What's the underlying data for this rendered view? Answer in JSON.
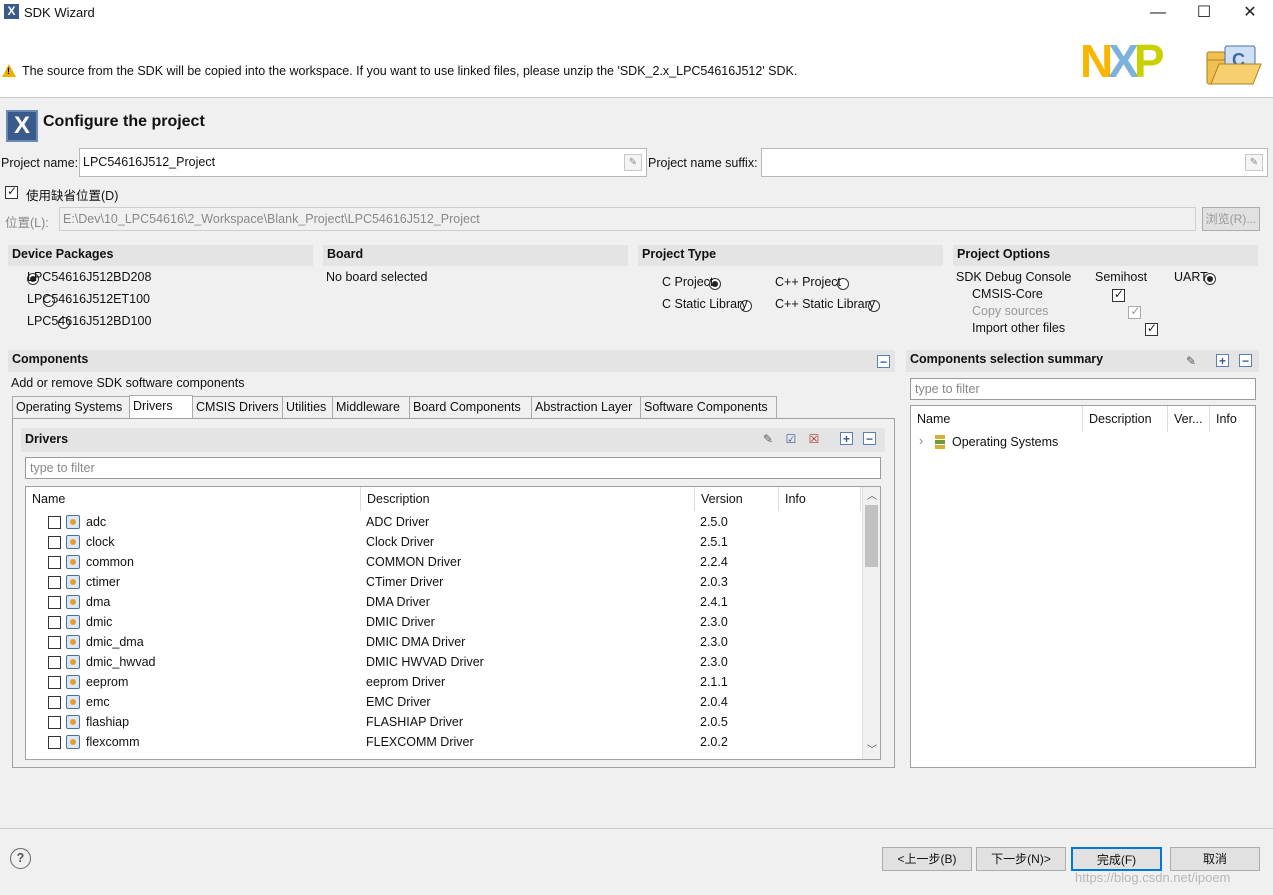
{
  "window": {
    "title": "SDK Wizard",
    "icon_glyph": "X",
    "minimize_glyph": "—",
    "maximize_glyph": "☐",
    "close_glyph": "✕"
  },
  "header": {
    "warning_glyph": "!",
    "message": "The source from the SDK will be copied into the workspace. If you want to use linked files, please unzip the 'SDK_2.x_LPC54616J512' SDK.",
    "logo_n": "N",
    "logo_x": "X",
    "logo_p": "P",
    "colors": {
      "n": "#f9b500",
      "x": "#7bb1db",
      "p": "#c9d200"
    }
  },
  "page": {
    "title": "Configure the project",
    "icon_glyph": "X"
  },
  "project": {
    "name_label": "Project name:",
    "name_value": "LPC54616J512_Project",
    "suffix_label": "Project name suffix:",
    "suffix_value": "",
    "clear_glyph": "✎",
    "default_location_label": "使用缺省位置(D)",
    "location_label": "位置(L):",
    "location_value": "E:\\Dev\\10_LPC54616\\2_Workspace\\Blank_Project\\LPC54616J512_Project",
    "browse_label": "浏览(R)..."
  },
  "device_packages": {
    "heading": "Device Packages",
    "options": [
      "LPC54616J512BD208",
      "LPC54616J512ET100",
      "LPC54616J512BD100"
    ],
    "selected": "LPC54616J512BD208"
  },
  "board": {
    "heading": "Board",
    "value": "No board selected"
  },
  "project_type": {
    "heading": "Project Type",
    "options": [
      "C Project",
      "C++ Project",
      "C Static Library",
      "C++ Static Library"
    ],
    "selected": "C Project"
  },
  "project_options": {
    "heading": "Project Options",
    "debug_console_label": "SDK Debug Console",
    "debug_console_options": [
      "Semihost",
      "UART"
    ],
    "debug_console_selected": "Semihost",
    "cmsis_core": "CMSIS-Core",
    "copy_sources": "Copy sources",
    "import_other": "Import other files"
  },
  "components": {
    "heading": "Components",
    "collapse_glyph": "−",
    "subtitle": "Add or remove SDK software components",
    "tabs": [
      "Operating Systems",
      "Drivers",
      "CMSIS Drivers",
      "Utilities",
      "Middleware",
      "Board Components",
      "Abstraction Layer",
      "Software Components"
    ],
    "active_tab": "Drivers",
    "drivers": {
      "heading": "Drivers",
      "filter_placeholder": "type to filter",
      "toolbar": {
        "edit": "✎",
        "check": "☑",
        "uncheck": "☒",
        "expand": "+",
        "collapse": "−"
      },
      "columns": [
        "Name",
        "Description",
        "Version",
        "Info"
      ],
      "rows": [
        {
          "name": "adc",
          "desc": "ADC Driver",
          "ver": "2.5.0"
        },
        {
          "name": "clock",
          "desc": "Clock Driver",
          "ver": "2.5.1"
        },
        {
          "name": "common",
          "desc": "COMMON Driver",
          "ver": "2.2.4"
        },
        {
          "name": "ctimer",
          "desc": "CTimer Driver",
          "ver": "2.0.3"
        },
        {
          "name": "dma",
          "desc": "DMA Driver",
          "ver": "2.4.1"
        },
        {
          "name": "dmic",
          "desc": "DMIC Driver",
          "ver": "2.3.0"
        },
        {
          "name": "dmic_dma",
          "desc": "DMIC DMA Driver",
          "ver": "2.3.0"
        },
        {
          "name": "dmic_hwvad",
          "desc": "DMIC HWVAD Driver",
          "ver": "2.3.0"
        },
        {
          "name": "eeprom",
          "desc": "eeprom Driver",
          "ver": "2.1.1"
        },
        {
          "name": "emc",
          "desc": "EMC Driver",
          "ver": "2.0.4"
        },
        {
          "name": "flashiap",
          "desc": "FLASHIAP Driver",
          "ver": "2.0.5"
        },
        {
          "name": "flexcomm",
          "desc": "FLEXCOMM Driver",
          "ver": "2.0.2"
        }
      ],
      "scroll_up": "︿",
      "scroll_down": "﹀"
    }
  },
  "summary": {
    "heading": "Components selection summary",
    "filter_placeholder": "type to filter",
    "toolbar": {
      "edit": "✎",
      "expand": "+",
      "collapse": "−"
    },
    "columns": [
      "Name",
      "Description",
      "Ver...",
      "Info"
    ],
    "tree_item": "Operating Systems",
    "tree_arrow": "›"
  },
  "footer": {
    "help_glyph": "?",
    "back": "<上一步(B)",
    "next": "下一步(N)>",
    "finish": "完成(F)",
    "cancel": "取消",
    "watermark": "https://blog.csdn.net/ipoem"
  }
}
